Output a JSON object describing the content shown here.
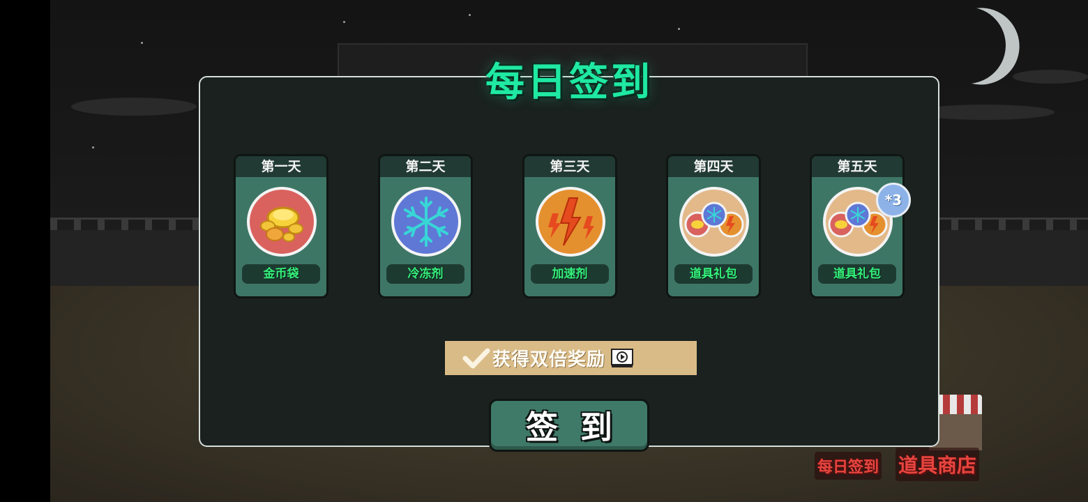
{
  "dialog": {
    "title": "每日签到",
    "days": [
      {
        "day_label": "第一天",
        "reward": "金币袋",
        "icon": "gold-coins-icon",
        "bg_color": "#d9625e"
      },
      {
        "day_label": "第二天",
        "reward": "冷冻剂",
        "icon": "snowflake-icon",
        "bg_color": "#5f78d6"
      },
      {
        "day_label": "第三天",
        "reward": "加速剂",
        "icon": "lightning-icon",
        "bg_color": "#e5902e"
      },
      {
        "day_label": "第四天",
        "reward": "道具礼包",
        "icon": "item-pack-icon",
        "bg_color": "#e3b98a"
      },
      {
        "day_label": "第五天",
        "reward": "道具礼包",
        "icon": "item-pack-icon",
        "bg_color": "#e3b98a",
        "badge": "*3"
      }
    ],
    "double_reward": {
      "label": "获得双倍奖励",
      "checked": true
    },
    "sign_button": "签到"
  },
  "bottom_links": {
    "daily_signin": "每日签到",
    "item_shop": "道具商店"
  },
  "colors": {
    "accent": "#1fe9a2",
    "card": "#3e7666",
    "reward_text": "#35f07b",
    "double_bar": "#d9bb87"
  }
}
